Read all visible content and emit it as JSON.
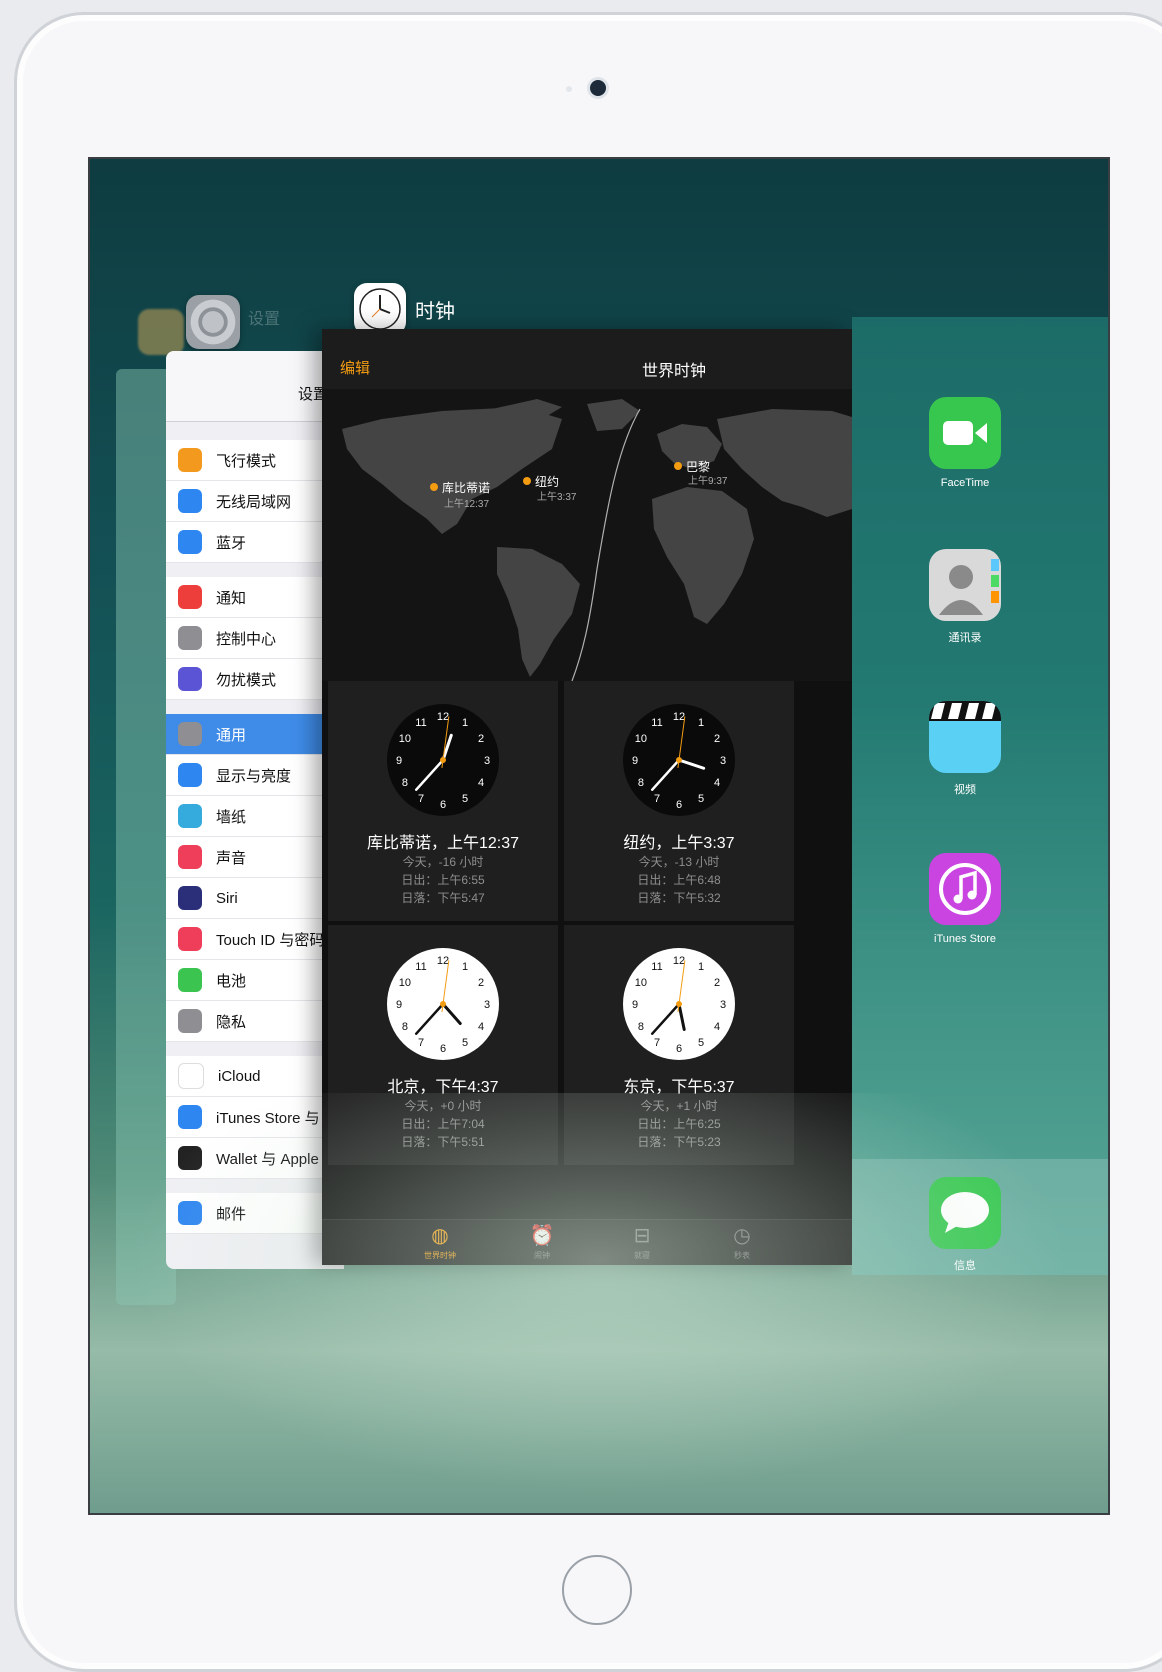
{
  "settings_app": {
    "label": "设置"
  },
  "clock_app": {
    "label": "时钟"
  },
  "settings": {
    "title": "设置",
    "groups": [
      [
        {
          "label": "飞行模式",
          "color": "#f39a1e"
        },
        {
          "label": "无线局域网",
          "color": "#2e86f1"
        },
        {
          "label": "蓝牙",
          "color": "#2e86f1"
        }
      ],
      [
        {
          "label": "通知",
          "color": "#ee3e3b"
        },
        {
          "label": "控制中心",
          "color": "#8e8e93"
        },
        {
          "label": "勿扰模式",
          "color": "#5b54d5"
        }
      ],
      [
        {
          "label": "通用",
          "color": "#8e8e93",
          "selected": true
        },
        {
          "label": "显示与亮度",
          "color": "#2e86f1"
        },
        {
          "label": "墙纸",
          "color": "#35aadc"
        },
        {
          "label": "声音",
          "color": "#ee3e5a"
        },
        {
          "label": "Siri",
          "color": "#2b2f7a"
        },
        {
          "label": "Touch ID 与密码",
          "color": "#ee3e5a"
        },
        {
          "label": "电池",
          "color": "#3cc451"
        },
        {
          "label": "隐私",
          "color": "#8e8e93"
        }
      ],
      [
        {
          "label": "iCloud",
          "color": "#ffffff"
        },
        {
          "label": "iTunes Store 与 App Store",
          "color": "#2e86f1"
        },
        {
          "label": "Wallet 与 Apple Pay",
          "color": "#222222"
        }
      ],
      [
        {
          "label": "邮件",
          "color": "#2e86f1"
        }
      ]
    ]
  },
  "clock": {
    "edit_label": "编辑",
    "title": "世界时钟",
    "map_labels": [
      {
        "city": "库比蒂诺",
        "time": "上午12:37"
      },
      {
        "city": "纽约",
        "time": "上午3:37"
      },
      {
        "city": "巴黎",
        "time": "上午9:37"
      }
    ],
    "cities": [
      {
        "title": "库比蒂诺，上午12:37",
        "offset": "今天，-16 小时",
        "sunrise": "日出：上午6:55",
        "sunset": "日落：下午5:47",
        "dark": true,
        "hour": 0,
        "minute": 37
      },
      {
        "title": "纽约，上午3:37",
        "offset": "今天，-13 小时",
        "sunrise": "日出：上午6:48",
        "sunset": "日落：下午5:32",
        "dark": true,
        "hour": 3,
        "minute": 37
      },
      {
        "title": "北京，下午4:37",
        "offset": "今天，+0 小时",
        "sunrise": "日出：上午7:04",
        "sunset": "日落：下午5:51",
        "dark": false,
        "hour": 4,
        "minute": 37
      },
      {
        "title": "东京，下午5:37",
        "offset": "今天，+1 小时",
        "sunrise": "日出：上午6:25",
        "sunset": "日落：下午5:23",
        "dark": false,
        "hour": 5,
        "minute": 37
      }
    ],
    "tabs": [
      {
        "label": "世界时钟",
        "icon": "globe-icon",
        "active": true
      },
      {
        "label": "闹钟",
        "icon": "alarm-icon",
        "active": false
      },
      {
        "label": "就寝",
        "icon": "bed-icon",
        "active": false
      },
      {
        "label": "秒表",
        "icon": "stopwatch-icon",
        "active": false
      }
    ]
  },
  "home_apps": [
    {
      "label": "FaceTime",
      "icon": "facetime-icon"
    },
    {
      "label": "通讯录",
      "icon": "contacts-icon"
    },
    {
      "label": "视频",
      "icon": "videos-icon"
    },
    {
      "label": "iTunes Store",
      "icon": "itunes-store-icon"
    }
  ],
  "dock_apps": [
    {
      "label": "信息",
      "icon": "messages-icon"
    }
  ]
}
